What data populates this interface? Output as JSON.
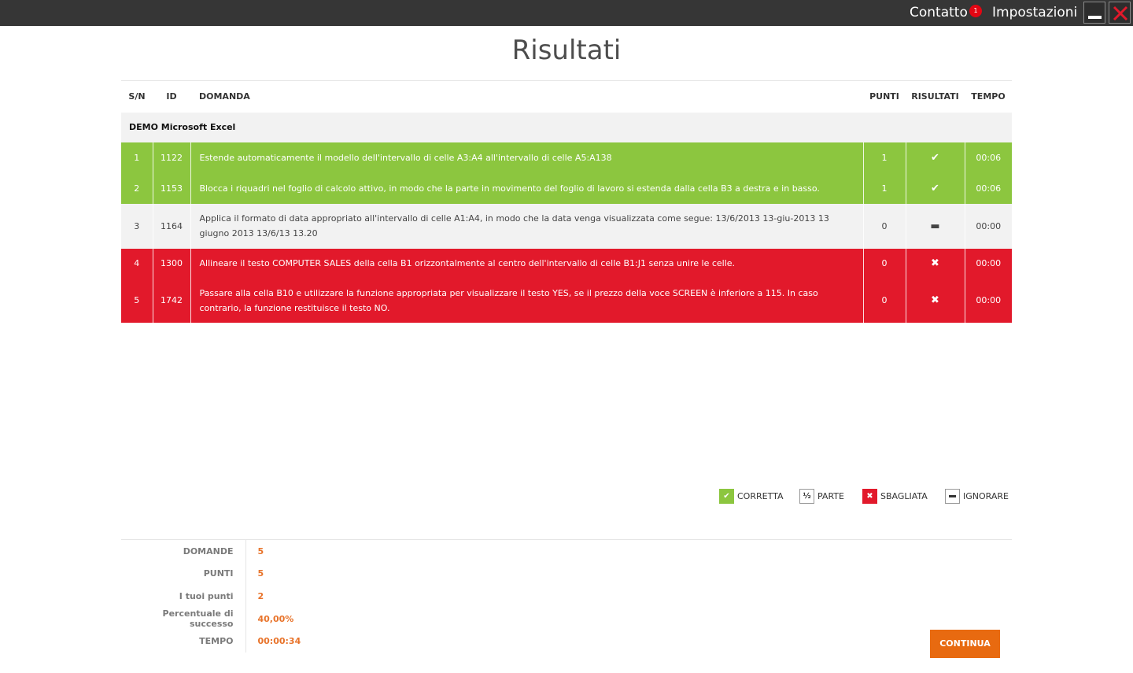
{
  "topbar": {
    "contact_label": "Contatto",
    "contact_badge": "1",
    "settings_label": "Impostazioni",
    "minimize_icon": "minimize-icon",
    "close_icon": "close-icon"
  },
  "page_title": "Risultati",
  "table": {
    "headers": {
      "sn": "S/N",
      "id": "ID",
      "question": "DOMANDA",
      "points": "PUNTI",
      "result": "RISULTATI",
      "time": "TEMPO"
    },
    "group": "DEMO Microsoft Excel",
    "rows": [
      {
        "sn": "1",
        "id": "1122",
        "question": "Estende automaticamente il modello dell'intervallo di celle A3:A4 all'intervallo di celle A5:A138",
        "points": "1",
        "result": "✔",
        "time": "00:06",
        "status": "correct"
      },
      {
        "sn": "2",
        "id": "1153",
        "question": "Blocca i riquadri nel foglio di calcolo attivo, in modo che la parte in movimento del foglio di lavoro si estenda dalla cella B3 a destra e in basso.",
        "points": "1",
        "result": "✔",
        "time": "00:06",
        "status": "correct"
      },
      {
        "sn": "3",
        "id": "1164",
        "question": "Applica il formato di data appropriato all'intervallo di celle A1:A4, in modo che la data venga visualizzata come segue: 13/6/2013 13-giu-2013 13 giugno 2013 13/6/13 13.20",
        "points": "0",
        "result": "▬",
        "time": "00:00",
        "status": "ignored"
      },
      {
        "sn": "4",
        "id": "1300",
        "question": "Allineare il testo COMPUTER SALES della cella B1 orizzontalmente al centro dell'intervallo di celle B1:J1 senza unire le celle.",
        "points": "0",
        "result": "✖",
        "time": "00:00",
        "status": "wrong"
      },
      {
        "sn": "5",
        "id": "1742",
        "question": "Passare alla cella B10 e utilizzare la funzione appropriata per visualizzare il testo YES, se il prezzo della voce SCREEN è inferiore a 115. In caso contrario, la funzione restituisce il testo NO.",
        "points": "0",
        "result": "✖",
        "time": "00:00",
        "status": "wrong"
      }
    ]
  },
  "legend": {
    "correct": "CORRETTA",
    "part": "PARTE",
    "part_symbol": "½",
    "wrong": "SBAGLIATA",
    "ignore": "IGNORARE"
  },
  "summary": [
    {
      "label": "DOMANDE",
      "value": "5"
    },
    {
      "label": "PUNTI",
      "value": "5"
    },
    {
      "label": "I tuoi punti",
      "value": "2"
    },
    {
      "label": "Percentuale di successo",
      "value": "40,00%"
    },
    {
      "label": "TEMPO",
      "value": "00:00:34"
    }
  ],
  "continue_label": "CONTINUA",
  "colors": {
    "correct": "#8cc63f",
    "wrong": "#e2192b",
    "ignored": "#f2f2f2",
    "accent": "#e86a10",
    "topbar": "#363636"
  }
}
